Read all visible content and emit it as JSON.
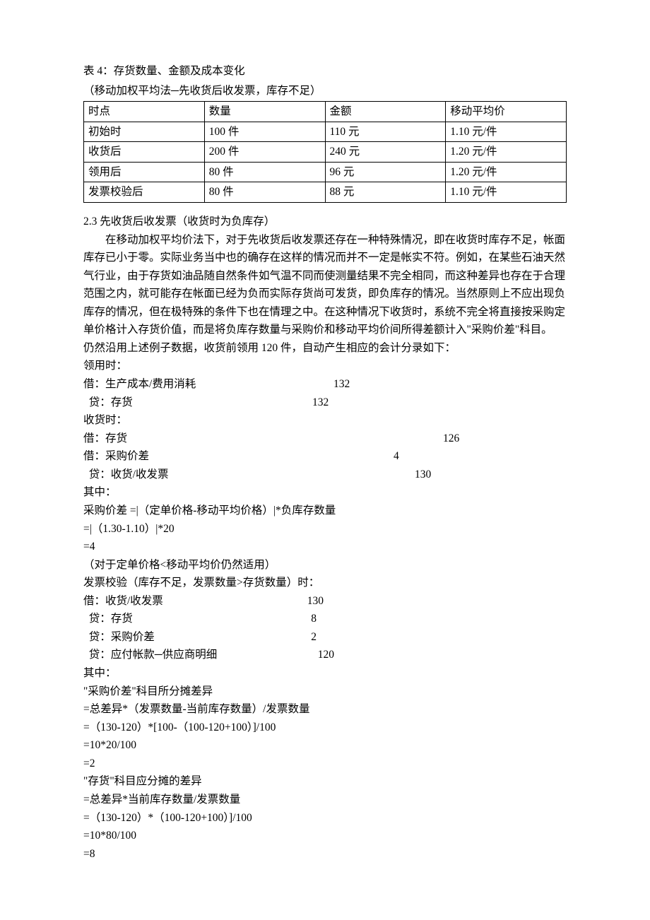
{
  "table4": {
    "title": "表 4：存货数量、金额及成本变化",
    "subtitle": "（移动加权平均法─先收货后收发票，库存不足）",
    "headers": [
      "时点",
      "数量",
      "金额",
      "移动平均价"
    ],
    "rows": [
      [
        "初始时",
        "100 件",
        "110 元",
        "1.10 元/件"
      ],
      [
        "收货后",
        "200 件",
        "240 元",
        "1.20 元/件"
      ],
      [
        "领用后",
        "80 件",
        "96 元",
        "1.20 元/件"
      ],
      [
        "发票校验后",
        "80 件",
        "88 元",
        "1.10 元/件"
      ]
    ]
  },
  "section": {
    "heading": "2.3 先收货后收发票（收货时为负库存）",
    "para": "在移动加权平均价法下，对于先收货后收发票还存在一种特殊情况，即在收货时库存不足，帐面库存已小于零。实际业务当中也的确存在这样的情况而并不一定是帐实不符。例如，在某些石油天然气行业，由于存货如油品随自然条件如气温不同而使测量结果不完全相同，而这种差异也存在于合理范围之内，就可能存在帐面已经为负而实际存货尚可发货，即负库存的情况。当然原则上不应出现负库存的情况，但在极特殊的条件下也在情理之中。在这种情况下收货时，系统不完全将直接按采购定单价格计入存货价值，而是将负库存数量与采购价和移动平均价间所得差额计入\"采购价差\"科目。",
    "intro2": "仍然沿用上述例子数据，收货前领用 120 件，自动产生相应的会计分录如下：",
    "entries": {
      "use_title": "领用时：",
      "use1_label": "借：生产成本/费用消耗",
      "use1_amt": "132",
      "use2_label": "  贷：存货",
      "use2_amt": "132",
      "recv_title": "收货时：",
      "recv1_label": "借：存货",
      "recv1_amt": "126",
      "recv2_label": "借：采购价差",
      "recv2_amt": "4",
      "recv3_label": "  贷：收货/收发票",
      "recv3_amt": "130",
      "calc_title": "其中：",
      "calc1": "采购价差 =|（定单价格-移动平均价格）|*负库存数量",
      "calc2": "=|（1.30-1.10）|*20",
      "calc3": "=4",
      "calc4": "（对于定单价格<移动平均价仍然适用）",
      "inv_title": "发票校验（库存不足，发票数量>存货数量）时：",
      "inv1_label": "借：收货/收发票",
      "inv1_amt": "130",
      "inv2_label": "  贷：存货",
      "inv2_amt": "8",
      "inv3_label": "  贷：采购价差",
      "inv3_amt": "2",
      "inv4_label": "  贷：应付帐款─供应商明细",
      "inv4_amt": "120",
      "calc2_title": "其中：",
      "d1": "\"采购价差\"科目所分摊差异",
      "d2": "=总差异*（发票数量-当前库存数量）/发票数量",
      "d3": "=（130-120）*[100-（100-120+100）]/100",
      "d4": "=10*20/100",
      "d5": "=2",
      "d6": "\"存货\"科目应分摊的差异",
      "d7": "=总差异*当前库存数量/发票数量",
      "d8": "=（130-120）*（100-120+100）]/100",
      "d9": "=10*80/100",
      "d10": "=8"
    }
  }
}
